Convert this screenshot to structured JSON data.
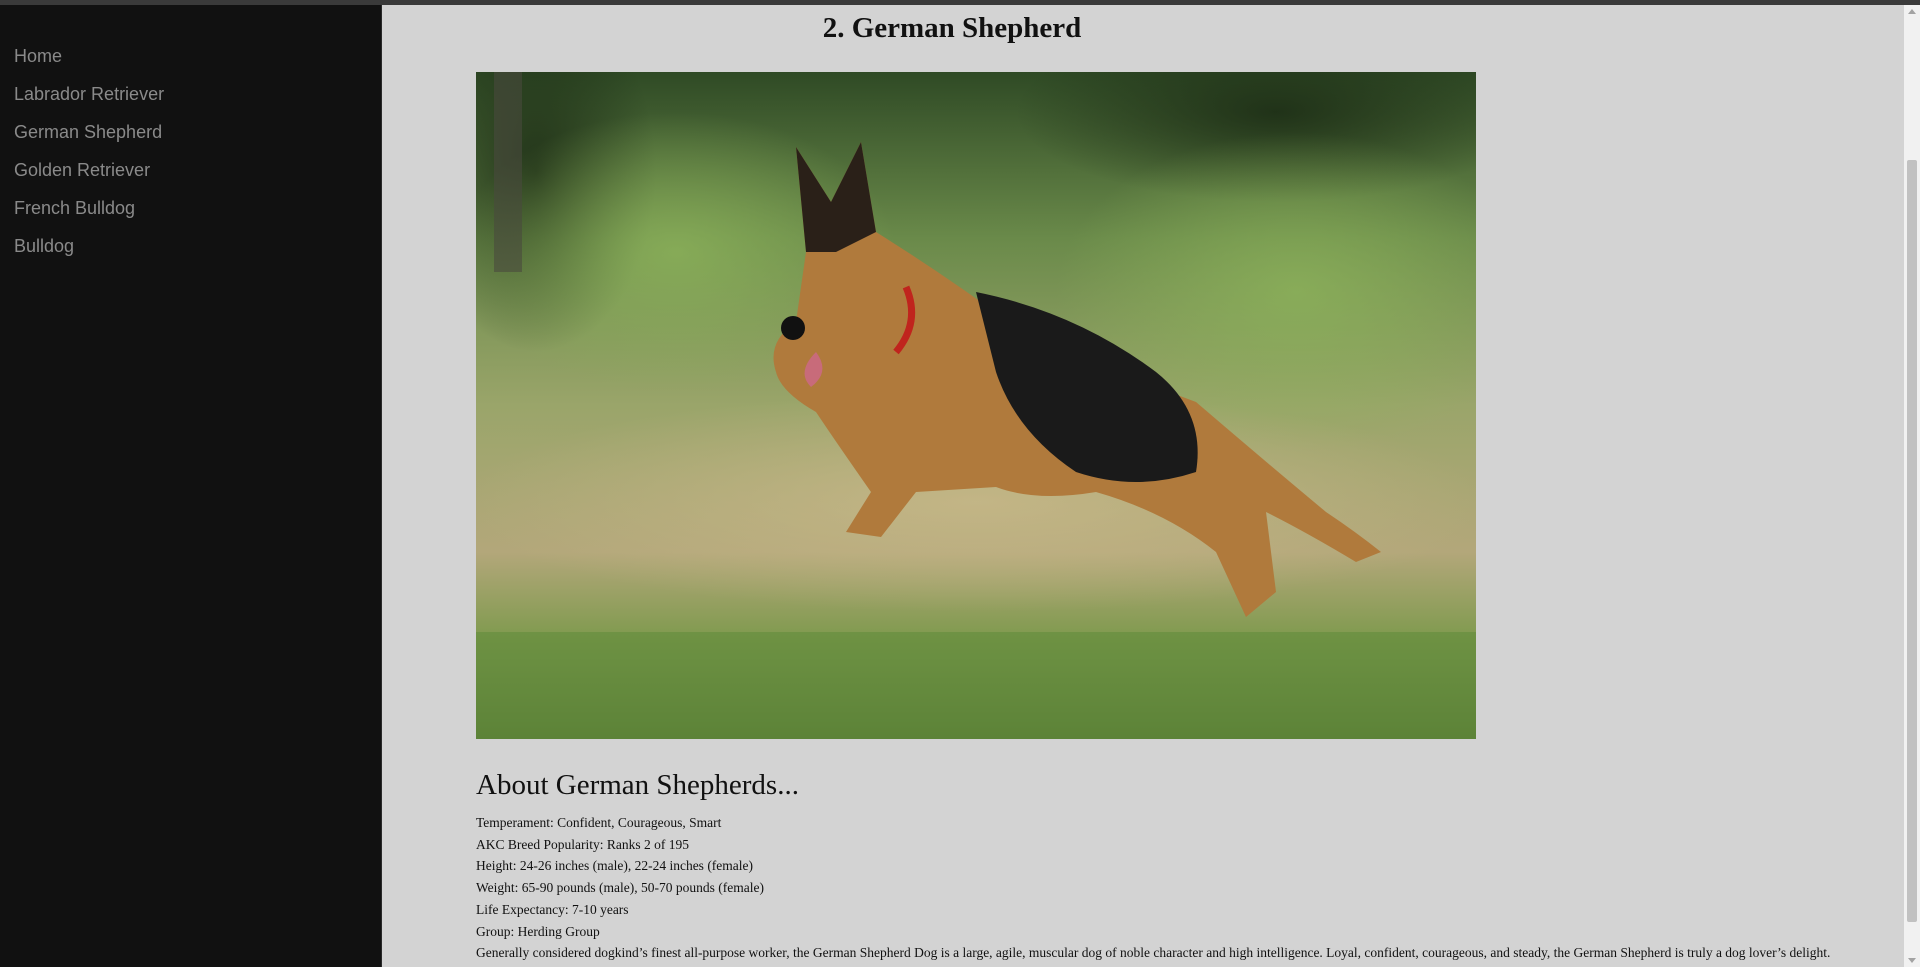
{
  "nav": {
    "items": [
      {
        "label": "Home"
      },
      {
        "label": "Labrador Retriever"
      },
      {
        "label": "German Shepherd"
      },
      {
        "label": "Golden Retriever"
      },
      {
        "label": "French Bulldog"
      },
      {
        "label": "Bulldog"
      }
    ]
  },
  "main": {
    "title": "2. German Shepherd",
    "about_title": "About German Shepherds...",
    "facts": {
      "temperament": "Temperament: Confident, Courageous, Smart",
      "popularity": "AKC Breed Popularity: Ranks 2 of 195",
      "height": "Height: 24-26 inches (male), 22-24 inches (female)",
      "weight": "Weight: 65-90 pounds (male), 50-70 pounds (female)",
      "life": "Life Expectancy: 7-10 years",
      "group": "Group: Herding Group",
      "description": "Generally considered dogkind’s finest all-purpose worker, the German Shepherd Dog is a large, agile, muscular dog of noble character and high intelligence. Loyal, confident, courageous, and steady, the German Shepherd is truly a dog lover’s delight."
    }
  },
  "colors": {
    "sidebar_bg": "#111111",
    "nav_text": "#8a8a8a",
    "page_bg": "#d3d3d3"
  }
}
